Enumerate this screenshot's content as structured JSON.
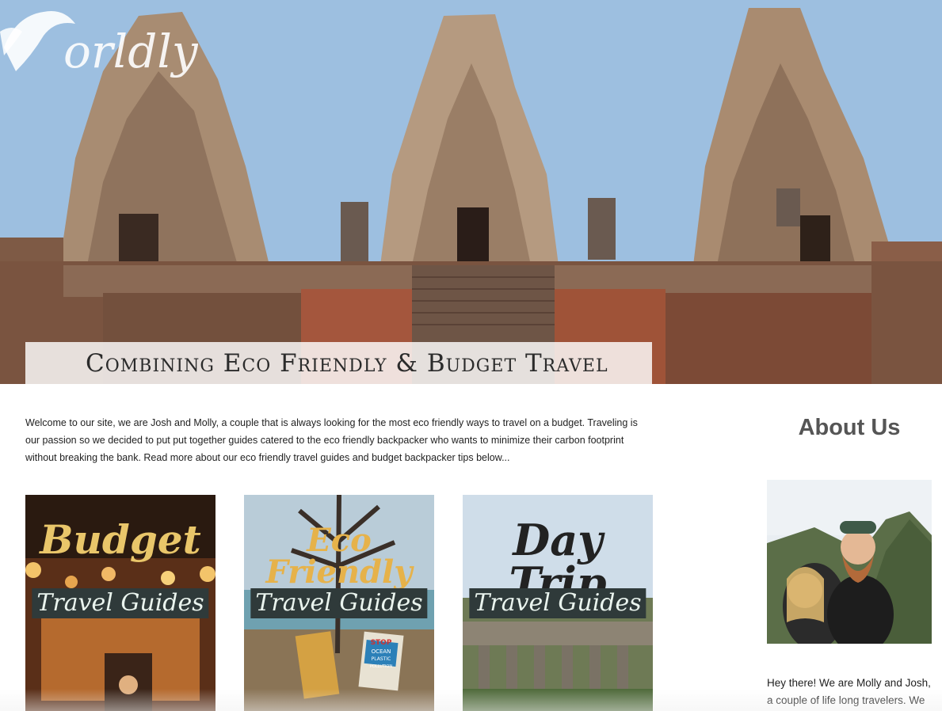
{
  "hero": {
    "title": "Combining Eco Friendly & Budget Travel",
    "logo_text": "orldly"
  },
  "intro": {
    "text": "Welcome to our site, we are Josh and Molly, a couple that is always looking for the most eco friendly ways to travel on a budget. Traveling is our passion so we decided to put put together guides catered to the eco friendly backpacker who wants to minimize their carbon footprint without breaking the bank. Read more about our eco friendly travel guides and budget backpacker tips below..."
  },
  "cards": [
    {
      "title": "Budget",
      "subtitle": "Travel Guides",
      "title_color": "#e9c66a"
    },
    {
      "title": "Eco Friendly",
      "subtitle": "Travel Guides",
      "title_color": "#e6b24a",
      "sign_text": "STOP OCEAN PLASTIC POLLUTION"
    },
    {
      "title": "Day Trip",
      "subtitle": "Travel Guides",
      "title_color": "#222222"
    }
  ],
  "sidebar": {
    "heading": "About Us",
    "text": "Hey there! We are Molly and Josh, a couple of life long travelers. We"
  }
}
